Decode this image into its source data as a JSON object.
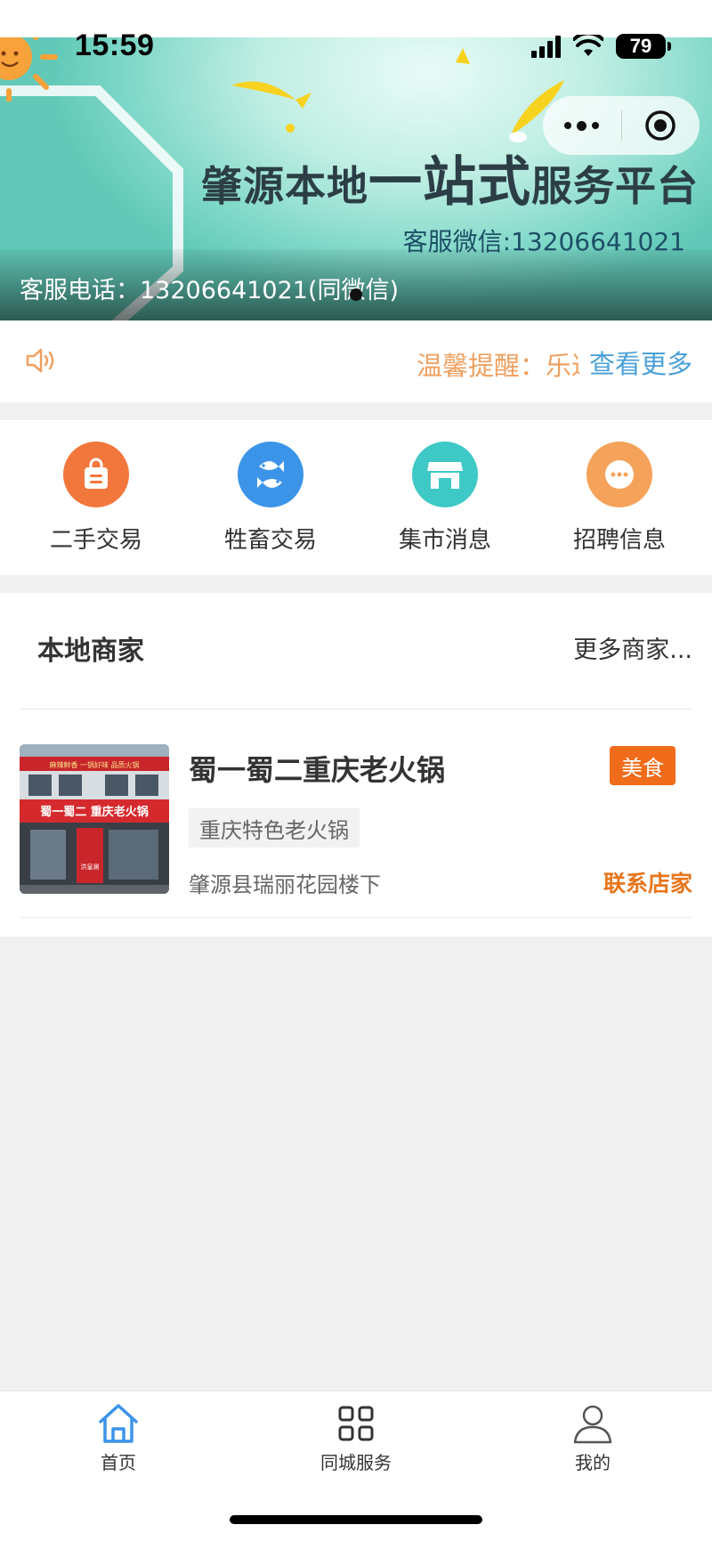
{
  "status_bar": {
    "time": "15:59",
    "battery": "79"
  },
  "banner": {
    "title_part1": "肇源本地",
    "title_part2": "一站式",
    "title_part3": "服务平台",
    "wechat": "客服微信:13206641021",
    "caption": "客服电话：13206641021(同微信)"
  },
  "notice": {
    "text": "温馨提醒：乐达",
    "more_label": "查看更多"
  },
  "categories": [
    {
      "label": "二手交易",
      "icon": "shopping-bag-icon",
      "color": "#f2773c"
    },
    {
      "label": "牲畜交易",
      "icon": "fish-icon",
      "color": "#3b94e8"
    },
    {
      "label": "集市消息",
      "icon": "shop-icon",
      "color": "#3ec9c6"
    },
    {
      "label": "招聘信息",
      "icon": "chat-dots-icon",
      "color": "#f5a35a"
    }
  ],
  "merchants": {
    "title": "本地商家",
    "more_label": "更多商家...",
    "items": [
      {
        "name": "蜀一蜀二重庆老火锅",
        "tag": "美食",
        "chip": "重庆特色老火锅",
        "address": "肇源县瑞丽花园楼下",
        "contact_label": "联系店家",
        "sign_text": "蜀一蜀二 重庆老火锅",
        "sign_top": "麻辣鲜香 一锅好味 品质火锅",
        "door_text": "洪皇涮"
      }
    ]
  },
  "tabbar": {
    "items": [
      {
        "label": "首页",
        "icon": "home-icon",
        "active": true
      },
      {
        "label": "同城服务",
        "icon": "grid-icon",
        "active": false
      },
      {
        "label": "我的",
        "icon": "user-icon",
        "active": false
      }
    ]
  },
  "colors": {
    "accent_blue": "#3b94e8",
    "accent_orange": "#f06c1a",
    "notice_orange": "#f0a060",
    "link_blue": "#4aa0d8"
  }
}
